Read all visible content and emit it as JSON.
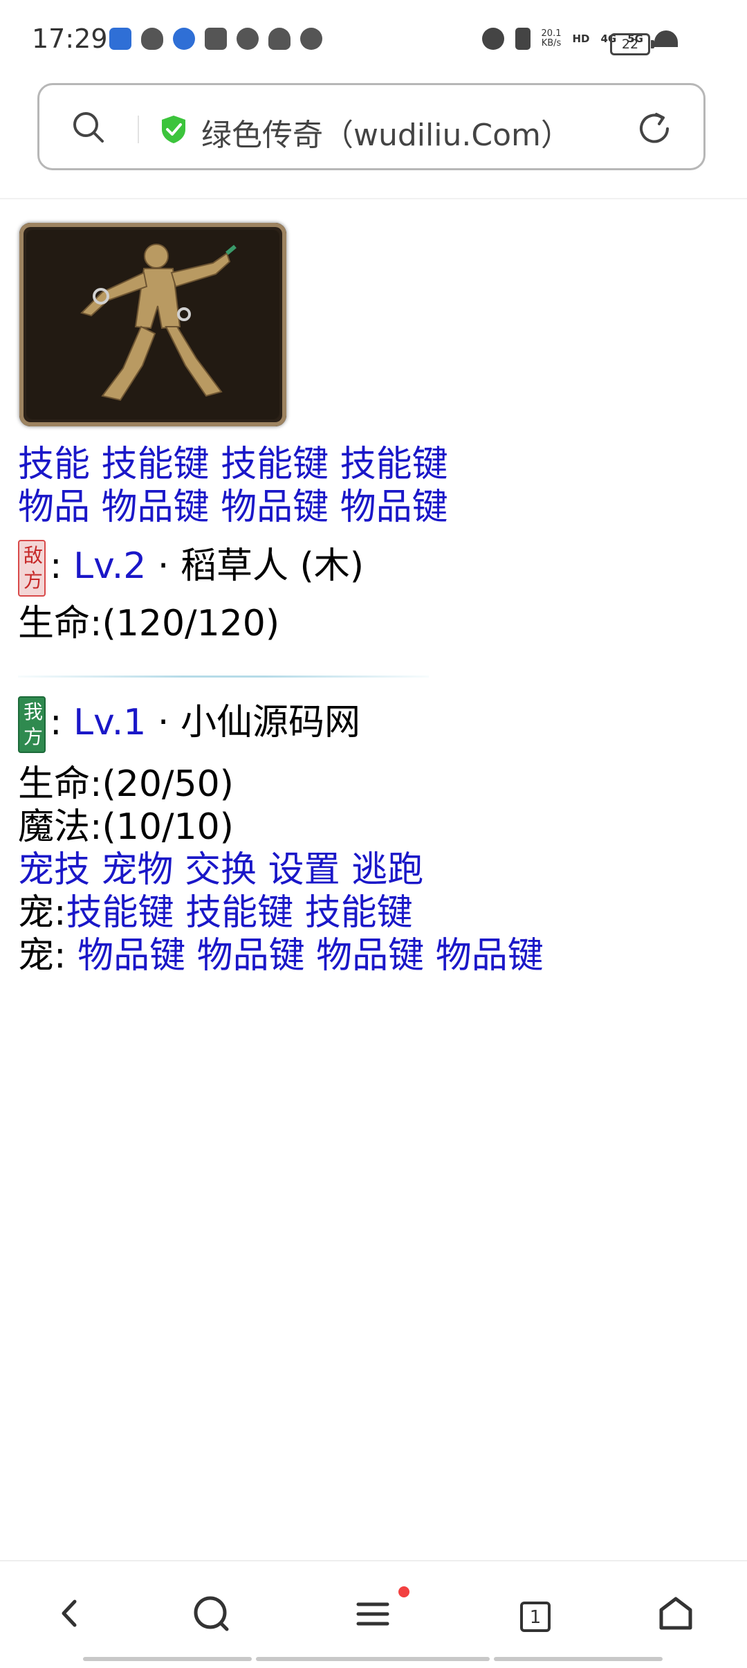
{
  "status_bar": {
    "time": "17:29",
    "net_speed_value": "20.1",
    "net_speed_unit": "KB/s",
    "hd": "HD",
    "signal_4g": "4G",
    "signal_5g": "5G",
    "battery": "22"
  },
  "address_bar": {
    "title": "绿色传奇（wudiliu.Com）",
    "icons": [
      "search-icon",
      "shield-check-icon",
      "reload-icon"
    ],
    "shield_color": "#3cc43c"
  },
  "battle": {
    "skills_row": {
      "label": "技能",
      "keys": [
        "技能键",
        "技能键",
        "技能键"
      ]
    },
    "items_row": {
      "label": "物品",
      "keys": [
        "物品键",
        "物品键",
        "物品键"
      ]
    },
    "enemy": {
      "badge_text": [
        "敌",
        "方"
      ],
      "colon": ":",
      "level": "Lv.2",
      "dot": "·",
      "name": "稻草人 (木)",
      "hp_line": "生命:(120/120)"
    },
    "player": {
      "badge_text": [
        "我",
        "方"
      ],
      "colon": ":",
      "level": "Lv.1",
      "dot": "·",
      "name": "小仙源码网",
      "hp_line": "生命:(20/50)",
      "mp_line": "魔法:(10/10)"
    },
    "actions": [
      "宠技",
      "宠物",
      "交换",
      "设置",
      "逃跑"
    ],
    "pet_skills": {
      "prefix": "宠:",
      "keys": [
        "技能键",
        "技能键",
        "技能键"
      ]
    },
    "pet_items": {
      "prefix": "宠:",
      "keys": [
        "物品键",
        "物品键",
        "物品键",
        "物品键"
      ]
    },
    "link_color": "#1a17c8"
  },
  "bottom_nav": {
    "tab_count": "1",
    "icons": [
      "back-icon",
      "search-icon",
      "menu-icon",
      "tabs-icon",
      "home-icon"
    ]
  }
}
